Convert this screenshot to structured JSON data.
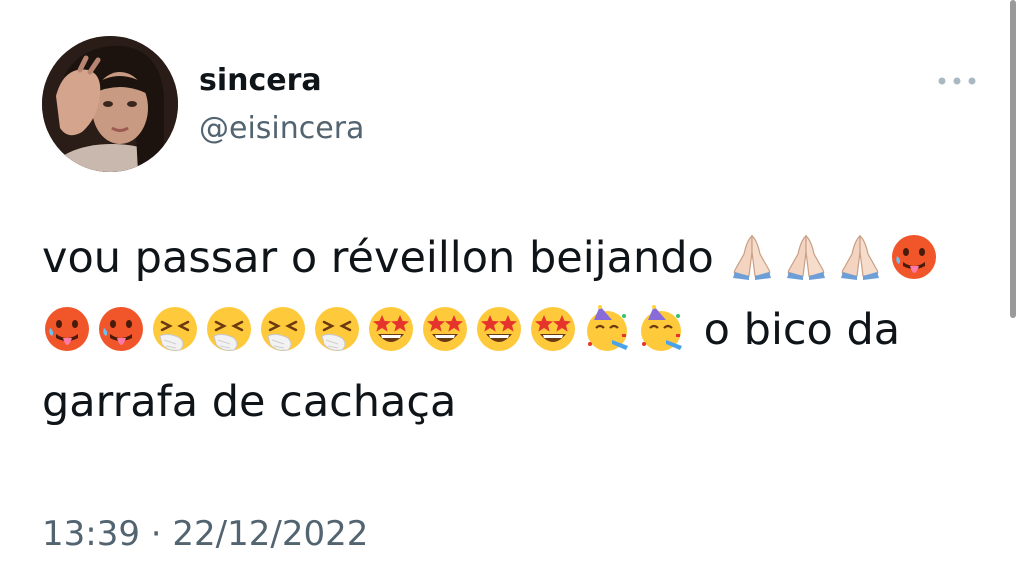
{
  "tweet": {
    "author_name": "sincera",
    "author_handle": "@eisincera",
    "text_line1_prefix": "vou passar o réveillon beijando ",
    "text_line3_suffix": " o bico da garrafa de cachaça",
    "emoji_sequence": [
      "folded-hands",
      "folded-hands",
      "folded-hands",
      "hot-face",
      "hot-face",
      "hot-face",
      "sneezing-face",
      "sneezing-face",
      "sneezing-face",
      "sneezing-face",
      "star-struck",
      "star-struck",
      "star-struck",
      "star-struck",
      "partying-face",
      "partying-face"
    ],
    "timestamp": "13:39 · 22/12/2022"
  },
  "icons": {
    "more": "more-options-icon"
  },
  "colors": {
    "text": "#0f1419",
    "secondary": "#536471",
    "background": "#ffffff"
  }
}
